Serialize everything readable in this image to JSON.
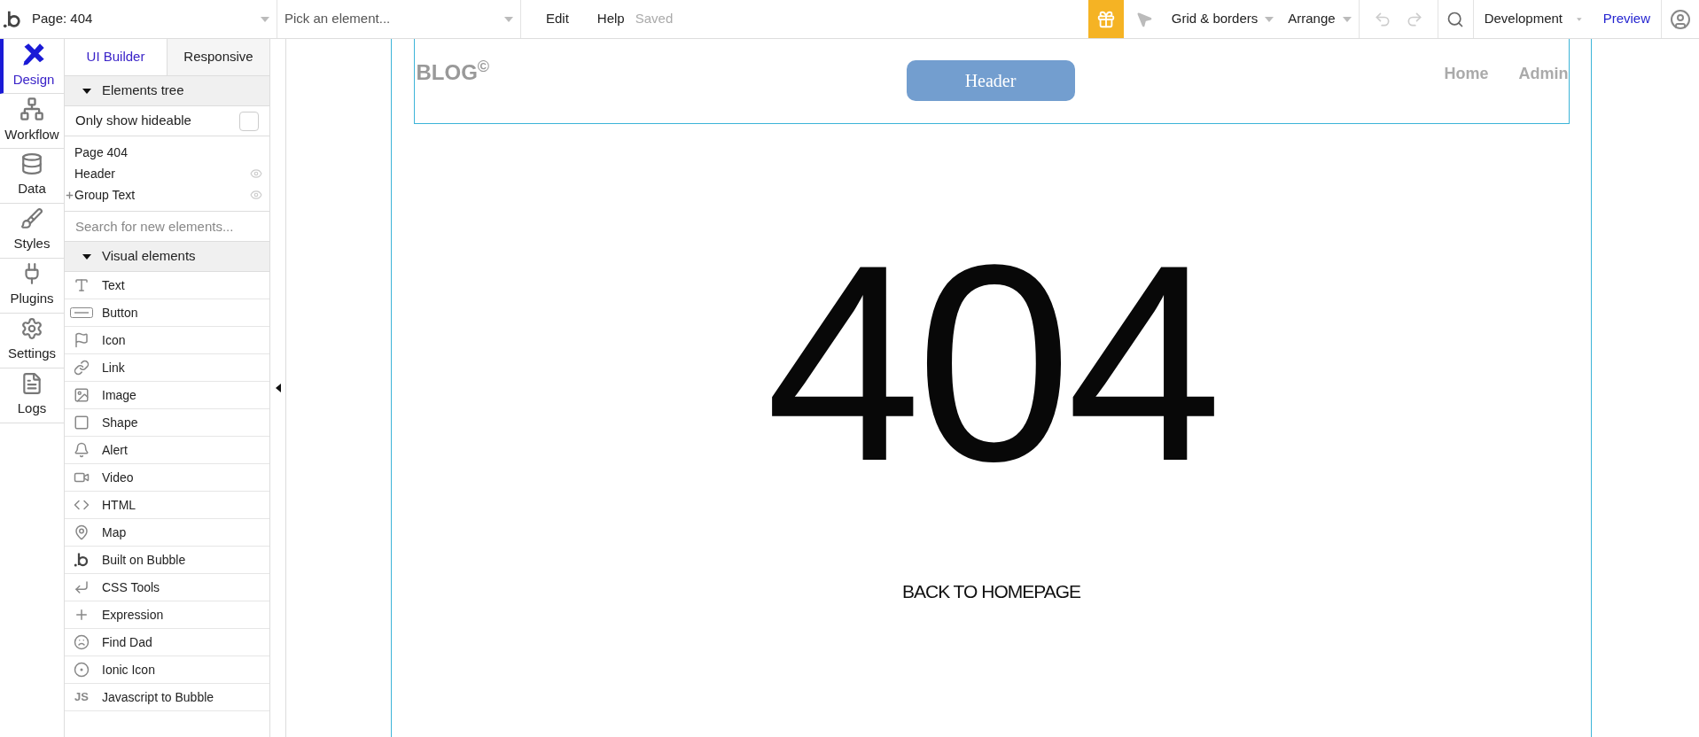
{
  "top_bar": {
    "page_select": "Page: 404",
    "element_select": {
      "placeholder": "Pick an element..."
    },
    "menu": [
      "Edit",
      "Help"
    ],
    "status": "Saved",
    "grid_menu": "Grid & borders",
    "arrange_menu": "Arrange",
    "environment": "Development",
    "preview": "Preview"
  },
  "rail": [
    {
      "label": "Design",
      "selected": true
    },
    {
      "label": "Workflow",
      "selected": false
    },
    {
      "label": "Data",
      "selected": false
    },
    {
      "label": "Styles",
      "selected": false
    },
    {
      "label": "Plugins",
      "selected": false
    },
    {
      "label": "Settings",
      "selected": false
    },
    {
      "label": "Logs",
      "selected": false
    }
  ],
  "tabs": [
    {
      "label": "UI Builder",
      "selected": true
    },
    {
      "label": "Responsive",
      "selected": false
    }
  ],
  "elements_tree": {
    "title": "Elements tree",
    "expanded": true,
    "filter": {
      "label": "Only show hideable",
      "checked": false
    },
    "items": [
      {
        "label": "Page 404",
        "expandable": false,
        "eye": false
      },
      {
        "label": "Header",
        "expandable": false,
        "eye": true
      },
      {
        "label": "Group Text",
        "expandable": true,
        "eye": true
      }
    ]
  },
  "search": {
    "placeholder": "Search for new elements..."
  },
  "visual_elements": {
    "title": "Visual elements",
    "expanded": true,
    "items": [
      {
        "label": "Text"
      },
      {
        "label": "Button"
      },
      {
        "label": "Icon"
      },
      {
        "label": "Link"
      },
      {
        "label": "Image"
      },
      {
        "label": "Shape"
      },
      {
        "label": "Alert"
      },
      {
        "label": "Video"
      },
      {
        "label": "HTML"
      },
      {
        "label": "Map"
      },
      {
        "label": "Built on Bubble"
      },
      {
        "label": "CSS Tools"
      },
      {
        "label": "Expression"
      },
      {
        "label": "Find Dad"
      },
      {
        "label": "Ionic Icon"
      },
      {
        "label": "Javascript to Bubble",
        "icon_text": "JS"
      }
    ]
  },
  "canvas": {
    "header": {
      "logo": "BLOG$^{©}$",
      "button": "Header",
      "nav": [
        "Home",
        "Admin"
      ]
    },
    "headline": "404",
    "link": "BACK TO HOMEPAGE"
  }
}
